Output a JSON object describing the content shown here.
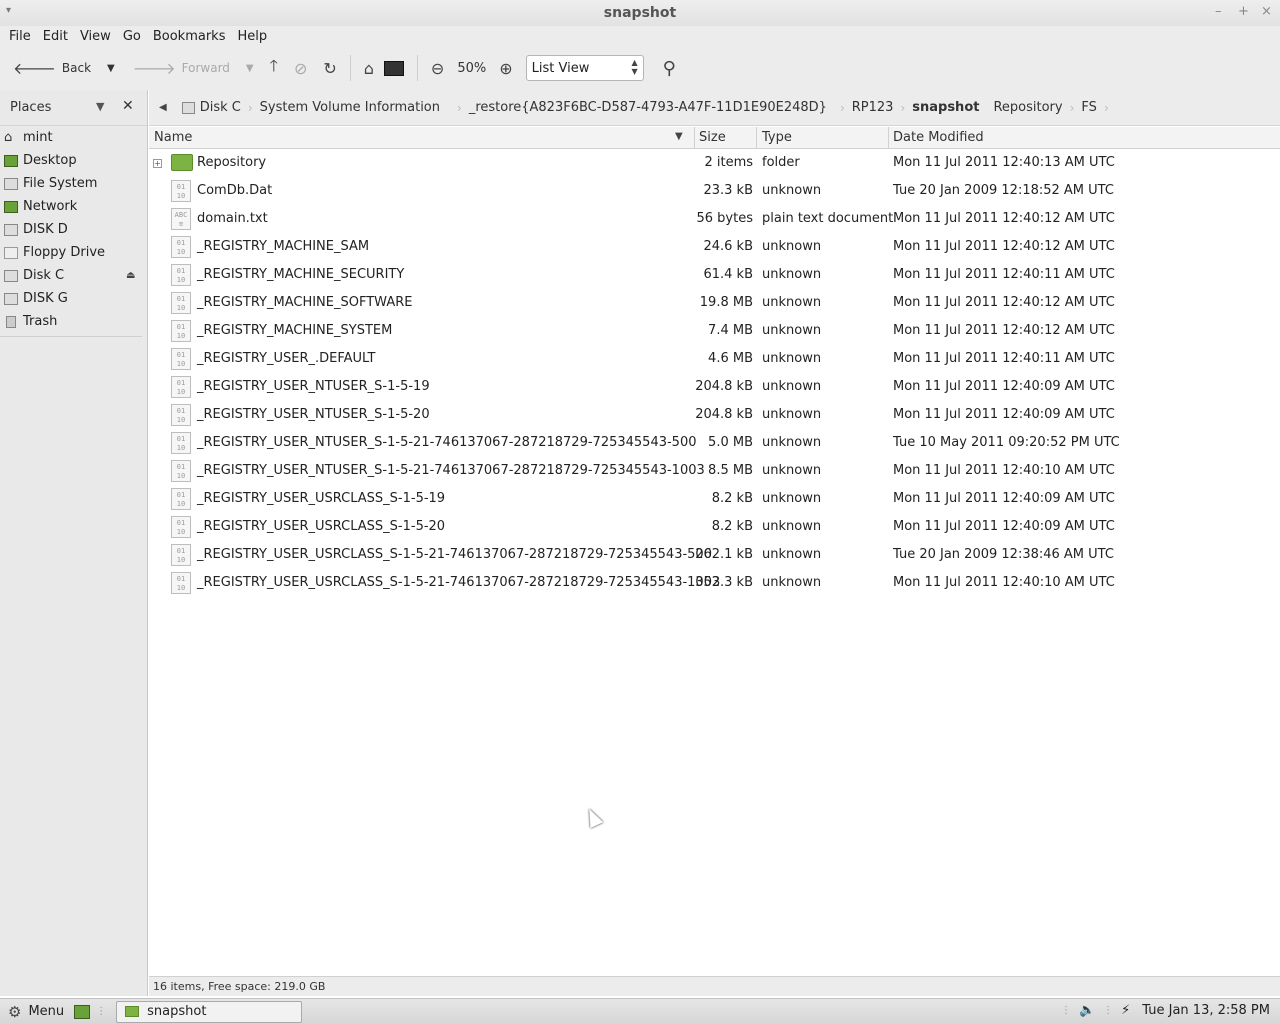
{
  "window": {
    "title": "snapshot",
    "menu_glyph": "▾",
    "controls": {
      "minimize": "–",
      "maximize": "+",
      "close": "×"
    }
  },
  "menubar": [
    "File",
    "Edit",
    "View",
    "Go",
    "Bookmarks",
    "Help"
  ],
  "toolbar": {
    "back_label": "Back",
    "forward_label": "Forward",
    "zoom": "50%",
    "view_mode": "List View",
    "icons": [
      "back-arrow-icon",
      "forward-arrow-icon",
      "up-icon",
      "stop-icon",
      "reload-icon",
      "home-icon",
      "computer-icon",
      "zoom-out-icon",
      "zoom-in-icon",
      "search-icon"
    ]
  },
  "sidebar": {
    "header": "Places",
    "items": [
      {
        "label": "mint",
        "icon": "home-icon"
      },
      {
        "label": "Desktop",
        "icon": "desktop-icon"
      },
      {
        "label": "File System",
        "icon": "drive-icon"
      },
      {
        "label": "Network",
        "icon": "network-icon"
      },
      {
        "label": "DISK D",
        "icon": "drive-icon"
      },
      {
        "label": "Floppy Drive",
        "icon": "floppy-icon"
      },
      {
        "label": "Disk C",
        "icon": "drive-icon",
        "eject": true
      },
      {
        "label": "DISK G",
        "icon": "drive-icon"
      },
      {
        "label": "Trash",
        "icon": "trash-icon"
      }
    ]
  },
  "pathbar": {
    "crumbs": [
      "Disk C",
      "System Volume Information",
      "_restore{A823F6BC-D587-4793-A47F-11D1E90E248D}",
      "RP123",
      "snapshot",
      "Repository",
      "FS"
    ],
    "active": "snapshot"
  },
  "columns": {
    "name": "Name",
    "size": "Size",
    "type": "Type",
    "date": "Date Modified"
  },
  "files": [
    {
      "name": "Repository",
      "size": "2 items",
      "type": "folder",
      "date": "Mon 11 Jul 2011 12:40:13 AM UTC",
      "kind": "folder"
    },
    {
      "name": "ComDb.Dat",
      "size": "23.3 kB",
      "type": "unknown",
      "date": "Tue 20 Jan 2009 12:18:52 AM UTC",
      "kind": "binary"
    },
    {
      "name": "domain.txt",
      "size": "56 bytes",
      "type": "plain text document",
      "date": "Mon 11 Jul 2011 12:40:12 AM UTC",
      "kind": "text"
    },
    {
      "name": "_REGISTRY_MACHINE_SAM",
      "size": "24.6 kB",
      "type": "unknown",
      "date": "Mon 11 Jul 2011 12:40:12 AM UTC",
      "kind": "binary"
    },
    {
      "name": "_REGISTRY_MACHINE_SECURITY",
      "size": "61.4 kB",
      "type": "unknown",
      "date": "Mon 11 Jul 2011 12:40:11 AM UTC",
      "kind": "binary"
    },
    {
      "name": "_REGISTRY_MACHINE_SOFTWARE",
      "size": "19.8 MB",
      "type": "unknown",
      "date": "Mon 11 Jul 2011 12:40:12 AM UTC",
      "kind": "binary"
    },
    {
      "name": "_REGISTRY_MACHINE_SYSTEM",
      "size": "7.4 MB",
      "type": "unknown",
      "date": "Mon 11 Jul 2011 12:40:12 AM UTC",
      "kind": "binary"
    },
    {
      "name": "_REGISTRY_USER_.DEFAULT",
      "size": "4.6 MB",
      "type": "unknown",
      "date": "Mon 11 Jul 2011 12:40:11 AM UTC",
      "kind": "binary"
    },
    {
      "name": "_REGISTRY_USER_NTUSER_S-1-5-19",
      "size": "204.8 kB",
      "type": "unknown",
      "date": "Mon 11 Jul 2011 12:40:09 AM UTC",
      "kind": "binary"
    },
    {
      "name": "_REGISTRY_USER_NTUSER_S-1-5-20",
      "size": "204.8 kB",
      "type": "unknown",
      "date": "Mon 11 Jul 2011 12:40:09 AM UTC",
      "kind": "binary"
    },
    {
      "name": "_REGISTRY_USER_NTUSER_S-1-5-21-746137067-287218729-725345543-500",
      "size": "5.0 MB",
      "type": "unknown",
      "date": "Tue 10 May 2011 09:20:52 PM UTC",
      "kind": "binary"
    },
    {
      "name": "_REGISTRY_USER_NTUSER_S-1-5-21-746137067-287218729-725345543-1003",
      "size": "8.5 MB",
      "type": "unknown",
      "date": "Mon 11 Jul 2011 12:40:10 AM UTC",
      "kind": "binary"
    },
    {
      "name": "_REGISTRY_USER_USRCLASS_S-1-5-19",
      "size": "8.2 kB",
      "type": "unknown",
      "date": "Mon 11 Jul 2011 12:40:09 AM UTC",
      "kind": "binary"
    },
    {
      "name": "_REGISTRY_USER_USRCLASS_S-1-5-20",
      "size": "8.2 kB",
      "type": "unknown",
      "date": "Mon 11 Jul 2011 12:40:09 AM UTC",
      "kind": "binary"
    },
    {
      "name": "_REGISTRY_USER_USRCLASS_S-1-5-21-746137067-287218729-725345543-500",
      "size": "262.1 kB",
      "type": "unknown",
      "date": "Tue 20 Jan 2009 12:38:46 AM UTC",
      "kind": "binary"
    },
    {
      "name": "_REGISTRY_USER_USRCLASS_S-1-5-21-746137067-287218729-725345543-1003",
      "size": "352.3 kB",
      "type": "unknown",
      "date": "Mon 11 Jul 2011 12:40:10 AM UTC",
      "kind": "binary"
    }
  ],
  "status": "16 items, Free space: 219.0 GB",
  "taskbar": {
    "menu_label": "Menu",
    "task_label": "snapshot",
    "clock": "Tue Jan 13,  2:58 PM"
  },
  "colors": {
    "folder": "#7cb342",
    "chrome": "#ececec"
  }
}
